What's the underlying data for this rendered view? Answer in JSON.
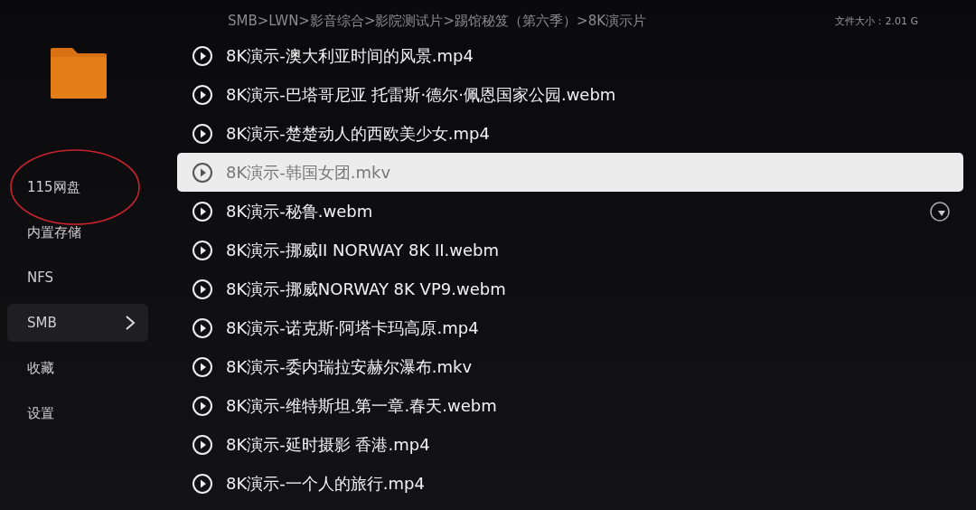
{
  "breadcrumb": "SMB>LWN>影音综合>影院测试片>踢馆秘笈（第六季）>8K演示片",
  "file_size": "文件大小：2.01 G",
  "sidebar": {
    "items": [
      {
        "label": "115网盘",
        "selected": false,
        "circled": true
      },
      {
        "label": "内置存储",
        "selected": false,
        "circled": false
      },
      {
        "label": "NFS",
        "selected": false,
        "circled": false
      },
      {
        "label": "SMB",
        "selected": true,
        "circled": false
      },
      {
        "label": "收藏",
        "selected": false,
        "circled": false
      },
      {
        "label": "设置",
        "selected": false,
        "circled": false
      }
    ]
  },
  "files": [
    {
      "name": "8K演示-澳大利亚时间的风景.mp4",
      "selected": false,
      "pointer": false
    },
    {
      "name": "8K演示-巴塔哥尼亚 托雷斯·德尔·佩恩国家公园.webm",
      "selected": false,
      "pointer": false
    },
    {
      "name": "8K演示-楚楚动人的西欧美少女.mp4",
      "selected": false,
      "pointer": false
    },
    {
      "name": "8K演示-韩国女团.mkv",
      "selected": true,
      "pointer": false
    },
    {
      "name": "8K演示-秘鲁.webm",
      "selected": false,
      "pointer": true
    },
    {
      "name": "8K演示-挪威II NORWAY 8K II.webm",
      "selected": false,
      "pointer": false
    },
    {
      "name": "8K演示-挪威NORWAY 8K VP9.webm",
      "selected": false,
      "pointer": false
    },
    {
      "name": "8K演示-诺克斯·阿塔卡玛高原.mp4",
      "selected": false,
      "pointer": false
    },
    {
      "name": "8K演示-委内瑞拉安赫尔瀑布.mkv",
      "selected": false,
      "pointer": false
    },
    {
      "name": "8K演示-维特斯坦.第一章.春天.webm",
      "selected": false,
      "pointer": false
    },
    {
      "name": "8K演示-延时摄影 香港.mp4",
      "selected": false,
      "pointer": false
    },
    {
      "name": "8K演示-一个人的旅行.mp4",
      "selected": false,
      "pointer": false
    }
  ]
}
